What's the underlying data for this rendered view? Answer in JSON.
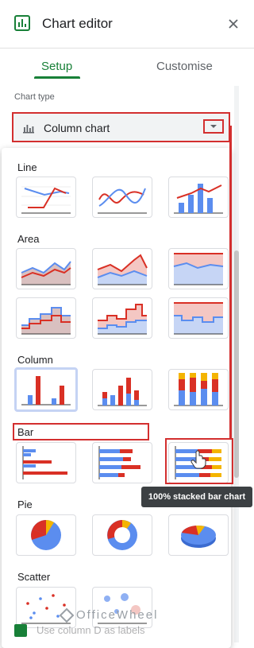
{
  "header": {
    "title": "Chart editor"
  },
  "tabs": [
    {
      "label": "Setup"
    },
    {
      "label": "Customise"
    }
  ],
  "chart_type": {
    "label": "Chart type",
    "value": "Column chart"
  },
  "sections": [
    {
      "title": "Line"
    },
    {
      "title": "Area"
    },
    {
      "title": "Column"
    },
    {
      "title": "Bar"
    },
    {
      "title": "Pie"
    },
    {
      "title": "Scatter"
    }
  ],
  "tooltip": "100% stacked bar chart",
  "bottom_option": "Use column D as labels",
  "watermark": "OfficeWheel",
  "colors": {
    "accent": "#188038",
    "blue": "#5b8def",
    "red": "#d93025",
    "yellow": "#f4b400",
    "highlight": "#d32f2f"
  }
}
